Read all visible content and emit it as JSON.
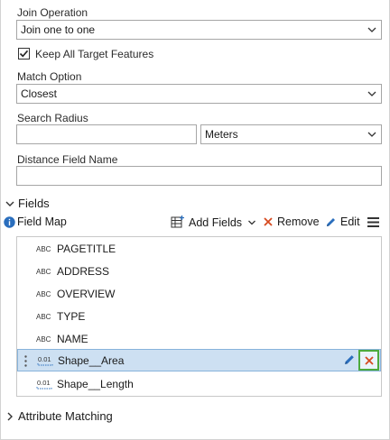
{
  "join_operation": {
    "label": "Join Operation",
    "value": "Join one to one"
  },
  "keep_all": {
    "label": "Keep All Target Features",
    "checked": true
  },
  "match_option": {
    "label": "Match Option",
    "value": "Closest"
  },
  "search_radius": {
    "label": "Search Radius",
    "value": "",
    "unit": "Meters"
  },
  "distance_field": {
    "label": "Distance Field Name",
    "value": ""
  },
  "fields_section": {
    "title": "Fields"
  },
  "field_map": {
    "label": "Field Map",
    "add_fields": "Add Fields",
    "remove": "Remove",
    "edit": "Edit"
  },
  "fields": [
    {
      "type_icon": "ABC",
      "name": "PAGETITLE"
    },
    {
      "type_icon": "ABC",
      "name": "ADDRESS"
    },
    {
      "type_icon": "ABC",
      "name": "OVERVIEW"
    },
    {
      "type_icon": "ABC",
      "name": "TYPE"
    },
    {
      "type_icon": "ABC",
      "name": "NAME"
    },
    {
      "type_icon": "0.01",
      "name": "Shape__Area",
      "selected": true
    },
    {
      "type_icon": "0.01",
      "name": "Shape__Length"
    }
  ],
  "attribute_matching": {
    "title": "Attribute Matching"
  },
  "colors": {
    "accent_blue": "#2a6ebd",
    "remove_red": "#d64a1f",
    "selection": "#cde0f2",
    "highlight_green": "#4caa3c"
  }
}
